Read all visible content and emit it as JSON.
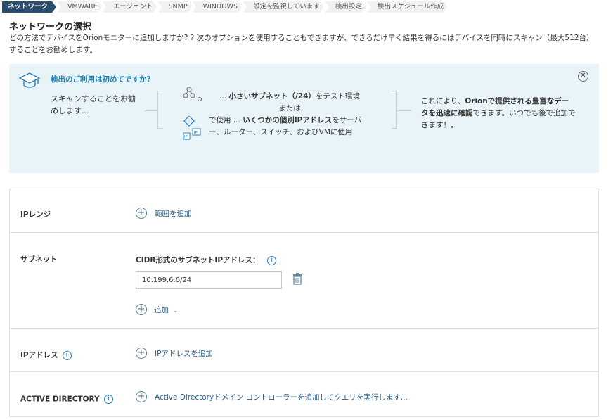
{
  "breadcrumb": [
    {
      "label": "ネットワーク",
      "active": true
    },
    {
      "label": "VMWARE"
    },
    {
      "label": "エージェント"
    },
    {
      "label": "SNMP"
    },
    {
      "label": "WINDOWS"
    },
    {
      "label": "設定を監視しています"
    },
    {
      "label": "検出設定"
    },
    {
      "label": "検出スケジュール作成"
    }
  ],
  "page": {
    "title": "ネットワークの選択",
    "description": "どの方法でデバイスをOrionモニターに追加しますか? ? 次のオプションを使用することもできますが、できるだけ早く結果を得るにはデバイスを同時にスキャン（最大512台）することをお勧めします。"
  },
  "info_panel": {
    "heading": "検出のご利用は初めてですか?",
    "left_text": "スキャンすることをお勧めします...",
    "mid_line1_a": "... ",
    "mid_line1_b": "小さいサブネット（/24）",
    "mid_line1_c": "をテスト環境",
    "mid_line2": "または",
    "mid_line3_a": "で使用 ... ",
    "mid_line3_b": "いくつかの個別IPアドレス",
    "mid_line3_c": "をサーバ",
    "mid_line4": "ー、ルーター、スイッチ、およびVMに使用",
    "right_a": "これにより、",
    "right_b": "Orionで提供される豊富なデータを迅速に確認",
    "right_c": "できます。いつでも後で追加できます！。",
    "close_symbol": "✕"
  },
  "sections": {
    "ip_range": {
      "label": "IPレンジ",
      "action": "範囲を追加"
    },
    "subnet": {
      "label": "サブネット",
      "field_label": "CIDR形式のサブネットIPアドレス：",
      "value": "10.199.6.0/24",
      "add_label": "追加"
    },
    "ip_address": {
      "label": "IPアドレス",
      "action": "IPアドレスを追加"
    },
    "active_directory": {
      "label": "ACTIVE DIRECTORY",
      "action": "Active Directoryドメイン コントローラーを追加してクエリを実行します..."
    }
  },
  "icons": {
    "info": "i",
    "plus": "+",
    "chevron": "⌄"
  },
  "colors": {
    "breadcrumb_active": "#2a4c6f",
    "info_panel_bg": "#e8f4f7",
    "heading_blue": "#1a7fb5",
    "link": "#2a5c8a"
  }
}
